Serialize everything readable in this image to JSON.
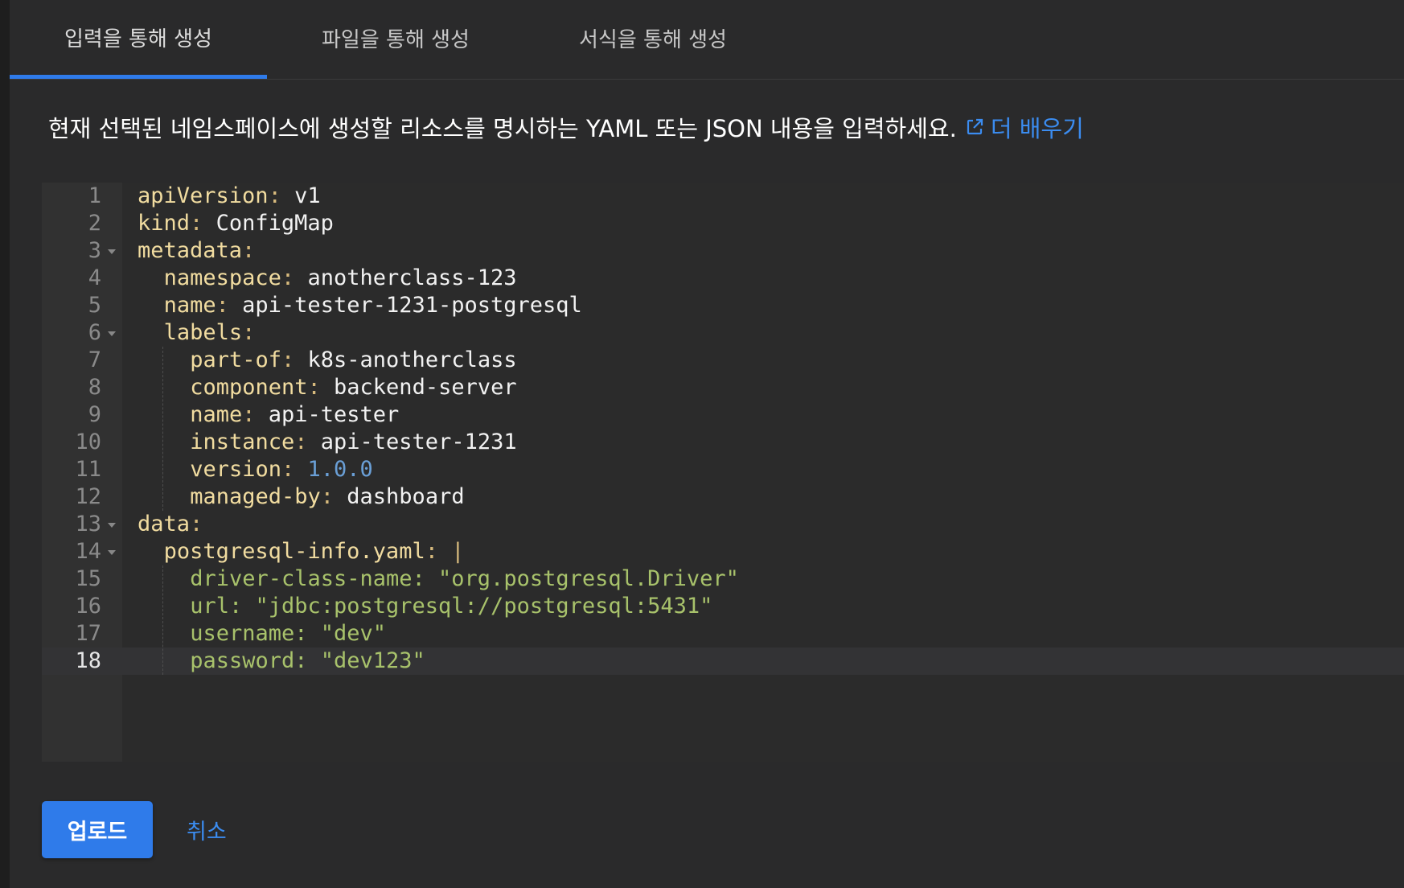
{
  "tabs": [
    {
      "label": "입력을 통해 생성",
      "active": true
    },
    {
      "label": "파일을 통해 생성",
      "active": false
    },
    {
      "label": "서식을 통해 생성",
      "active": false
    }
  ],
  "description": {
    "text": "현재 선택된 네임스페이스에 생성할 리소스를 명시하는 YAML 또는 JSON 내용을 입력하세요.",
    "learn_more": "더 배우기",
    "learn_more_icon": "external-link-icon"
  },
  "editor": {
    "current_line": 18,
    "lines": [
      {
        "n": "1",
        "key": "apiVersion",
        "val": "v1"
      },
      {
        "n": "2",
        "key": "kind",
        "val": "ConfigMap"
      },
      {
        "n": "3",
        "key": "metadata",
        "val": ""
      },
      {
        "n": "4",
        "key": "namespace",
        "val": "anotherclass-123"
      },
      {
        "n": "5",
        "key": "name",
        "val": "api-tester-1231-postgresql"
      },
      {
        "n": "6",
        "key": "labels",
        "val": ""
      },
      {
        "n": "7",
        "key": "part-of",
        "val": "k8s-anotherclass"
      },
      {
        "n": "8",
        "key": "component",
        "val": "backend-server"
      },
      {
        "n": "9",
        "key": "name",
        "val": "api-tester"
      },
      {
        "n": "10",
        "key": "instance",
        "val": "api-tester-1231"
      },
      {
        "n": "11",
        "key": "version",
        "val": "1.0.0"
      },
      {
        "n": "12",
        "key": "managed-by",
        "val": "dashboard"
      },
      {
        "n": "13",
        "key": "data",
        "val": ""
      },
      {
        "n": "14",
        "key": "postgresql-info.yaml",
        "val": "|"
      },
      {
        "n": "15",
        "text": "driver-class-name: \"org.postgresql.Driver\""
      },
      {
        "n": "16",
        "text": "url: \"jdbc:postgresql://postgresql:5431\""
      },
      {
        "n": "17",
        "text": "username: \"dev\""
      },
      {
        "n": "18",
        "text": "password: \"dev123\""
      }
    ]
  },
  "actions": {
    "upload_label": "업로드",
    "cancel_label": "취소"
  },
  "colors": {
    "accent": "#2f7bea",
    "link": "#3b8cf0",
    "yaml_key": "#f1dca0",
    "yaml_number": "#6a9fd6",
    "yaml_string": "#a8c26b"
  }
}
